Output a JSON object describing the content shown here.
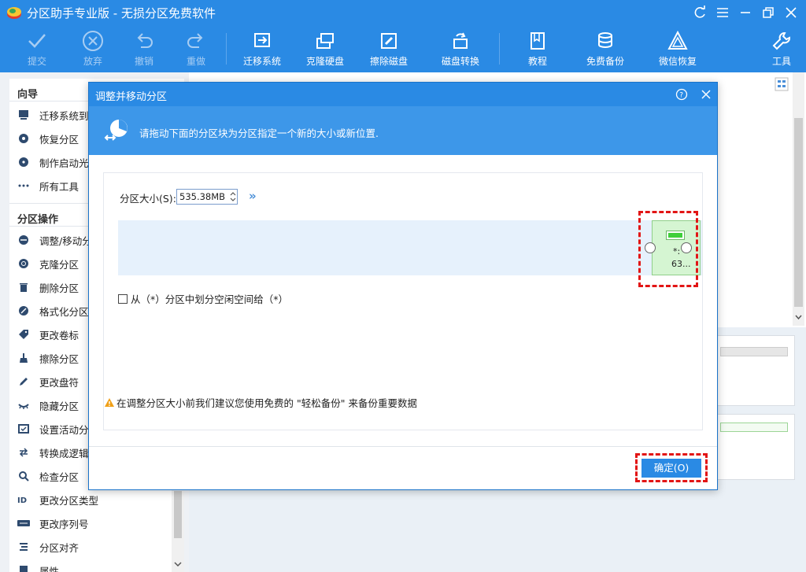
{
  "app": {
    "title": "分区助手专业版 - 无损分区免费软件"
  },
  "toolbar": {
    "items": [
      {
        "label": "提交",
        "icon": "check-icon",
        "disabled": true
      },
      {
        "label": "放弃",
        "icon": "cancel-circle-icon",
        "disabled": true
      },
      {
        "label": "撤销",
        "icon": "undo-icon",
        "disabled": true
      },
      {
        "label": "重做",
        "icon": "redo-icon",
        "disabled": true
      },
      {
        "label": "迁移系统",
        "icon": "migrate-os-icon"
      },
      {
        "label": "克隆硬盘",
        "icon": "clone-disk-icon"
      },
      {
        "label": "擦除磁盘",
        "icon": "wipe-disk-icon"
      },
      {
        "label": "磁盘转换",
        "icon": "disk-convert-icon"
      },
      {
        "label": "教程",
        "icon": "book-icon"
      },
      {
        "label": "免费备份",
        "icon": "backup-icon"
      },
      {
        "label": "微信恢复",
        "icon": "wechat-recovery-icon"
      },
      {
        "label": "工具",
        "icon": "wrench-icon"
      }
    ]
  },
  "sidebar": {
    "wizard_heading": "向导",
    "wizard_items": [
      "迁移系统到固",
      "恢复分区",
      "制作启动光盘",
      "所有工具"
    ],
    "ops_heading": "分区操作",
    "ops_items": [
      "调整/移动分区",
      "克隆分区",
      "删除分区",
      "格式化分区",
      "更改卷标",
      "擦除分区",
      "更改盘符",
      "隐藏分区",
      "设置活动分区",
      "转换成逻辑分区",
      "检查分区",
      "更改分区类型",
      "更改序列号",
      "分区对齐",
      "属性"
    ]
  },
  "dialog": {
    "title": "调整并移动分区",
    "banner_text": "请拖动下面的分区块为分区指定一个新的大小或新位置.",
    "size_label": "分区大小(S):",
    "size_value": "535.38MB",
    "expand_symbol": "»",
    "partition_label": "*:",
    "partition_size": "63...",
    "checkbox_label": "从（*）分区中划分空闲空间给（*）",
    "warning_text": "在调整分区大小前我们建议您使用免费的 \"轻松备份\" 来备份重要数据",
    "ok_label": "确定(O)"
  },
  "colors": {
    "accent": "#2a8ae4",
    "highlight": "#e21515",
    "partition_green": "#3fcf3a"
  }
}
